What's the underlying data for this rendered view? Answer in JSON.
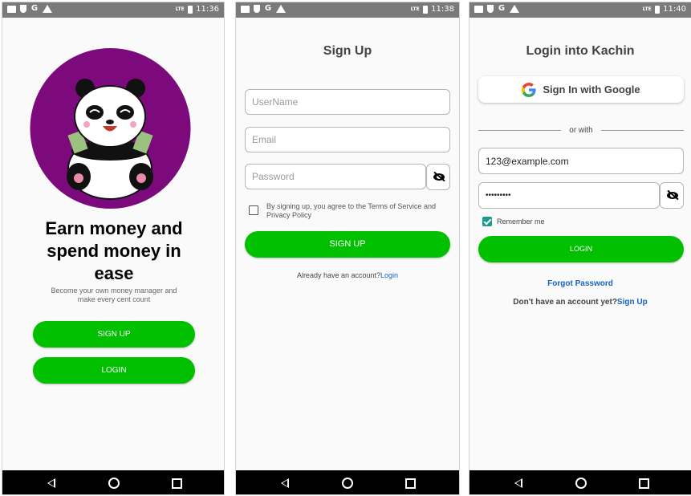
{
  "status_times": [
    "11:36",
    "11:38",
    "11:40"
  ],
  "status_signal": "LTE",
  "colors": {
    "brand_green": "#00c000",
    "purple": "#7d0a7d",
    "link_blue": "#1565c0",
    "checkbox_teal": "#1a9a8a"
  },
  "screen1": {
    "headline": "Earn money and spend money in ease",
    "subtitle": "Become your own money manager and make every cent count",
    "signup_label": "SIGN UP",
    "login_label": "LOGIN"
  },
  "screen2": {
    "title": "Sign Up",
    "username_placeholder": "UserName",
    "email_placeholder": "Email",
    "password_placeholder": "Password",
    "terms_text": "By signing up, you agree to the Terms of Service and Privacy Policy",
    "signup_label": "SIGN UP",
    "already_text": "Already have an account?",
    "login_link": "Login"
  },
  "screen3": {
    "title": "Login into Kachin",
    "google_label": "Sign In with Google",
    "or_with": "or with",
    "email_value": "123@example.com",
    "password_value": "•••••••••",
    "remember_label": "Remember me",
    "remember_checked": true,
    "login_label": "LOGIN",
    "forgot_label": "Forgot Password",
    "no_account_text": "Don't have an account yet?",
    "signup_link": "Sign Up"
  }
}
